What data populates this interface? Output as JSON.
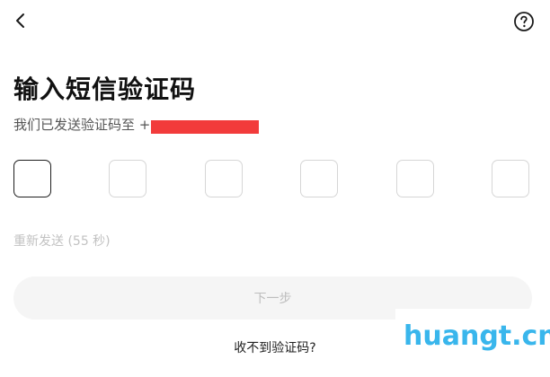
{
  "header": {
    "back_icon": "chevron-left-icon",
    "help_icon": "question-circle-icon"
  },
  "title": "输入短信验证码",
  "subtitle": {
    "prefix": "我们已发送验证码至 +",
    "redacted": true,
    "redaction_color": "#f23b3b"
  },
  "code_inputs": {
    "count": 6,
    "values": [
      "",
      "",
      "",
      "",
      "",
      ""
    ],
    "active_index": 0
  },
  "resend_text": "重新发送 (55 秒)",
  "next_button_label": "下一步",
  "no_code_link": "收不到验证码?",
  "watermark_text": "huangt.cn",
  "colors": {
    "watermark": "#39b6ec",
    "disabled_text": "#c2c2c2",
    "button_bg": "#f5f5f5"
  }
}
